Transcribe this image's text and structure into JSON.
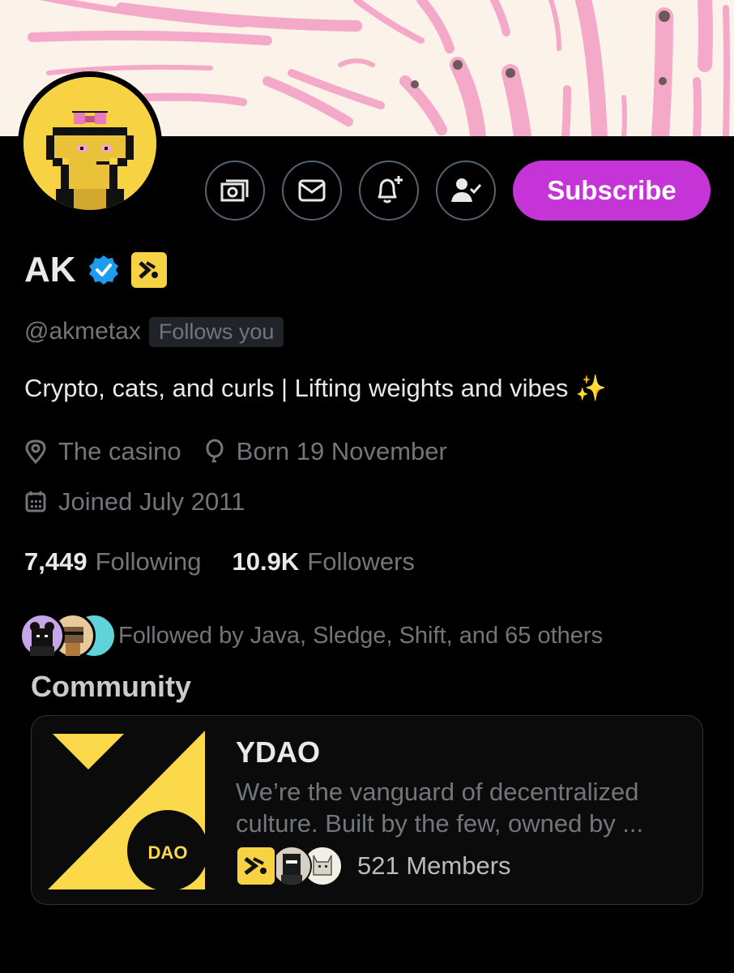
{
  "profile": {
    "name": "AK",
    "handle": "@akmetax",
    "follows_you": "Follows you",
    "bio": "Crypto, cats, and curls | Lifting weights and vibes ✨",
    "location": "The casino",
    "birthday": "Born 19 November",
    "joined": "Joined July 2011",
    "affiliate_badge": "X",
    "verified_icon": "verified-check-icon"
  },
  "actions": {
    "tip_icon": "money-icon",
    "message_icon": "envelope-icon",
    "notify_icon": "bell-plus-icon",
    "following_icon": "person-check-icon",
    "subscribe_label": "Subscribe"
  },
  "stats": {
    "following_count": "7,449",
    "following_label": "Following",
    "followers_count": "10.9K",
    "followers_label": "Followers"
  },
  "followed_by": {
    "text": "Followed by Java, Sledge, Shift, and 65 others"
  },
  "community": {
    "section_title": "Community",
    "name": "YDAO",
    "description": "We’re the vanguard of decentralized culture. Built by the few, owned by ...",
    "logo_text": "DAO",
    "members": "521 Members"
  },
  "colors": {
    "accent": "#c434d6",
    "verified": "#1d9bf0",
    "badge_yellow": "#f7d343",
    "muted": "#71767b",
    "banner_pink": "#f4a9c8"
  }
}
